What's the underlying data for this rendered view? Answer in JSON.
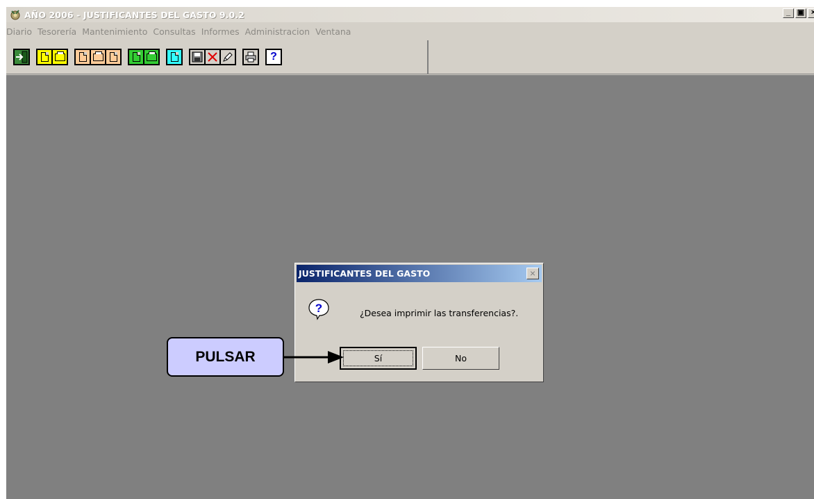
{
  "window": {
    "title": "AÑO 2006 - JUSTIFICANTES DEL GASTO 9.0.2",
    "controls": {
      "minimize": "_",
      "restore": "▣",
      "close": "×"
    }
  },
  "menubar": {
    "items": [
      "Diario",
      "Tesorería",
      "Mantenimiento",
      "Consultas",
      "Informes",
      "Administracion",
      "Ventana"
    ]
  },
  "toolbar": {
    "buttons": [
      {
        "icon": "exit-icon"
      },
      {
        "icon": "new-yellow-doc-icon",
        "accent": "#ffff00"
      },
      {
        "icon": "open-yellow-folder-icon",
        "accent": "#ffff00"
      },
      {
        "icon": "new-orange-doc-icon",
        "accent": "#ffcc99"
      },
      {
        "icon": "open-orange-folder-icon",
        "accent": "#ffcc99"
      },
      {
        "icon": "doc-orange-icon",
        "accent": "#ffcc99"
      },
      {
        "icon": "new-green-doc-icon",
        "accent": "#33cc33"
      },
      {
        "icon": "open-green-folder-icon",
        "accent": "#33cc33"
      },
      {
        "icon": "new-cyan-doc-icon",
        "accent": "#33ffff"
      },
      {
        "icon": "save-icon"
      },
      {
        "icon": "delete-icon"
      },
      {
        "icon": "edit-icon"
      },
      {
        "icon": "print-icon"
      },
      {
        "icon": "help-icon"
      }
    ],
    "help_label": "?"
  },
  "dialog": {
    "title": "JUSTIFICANTES DEL GASTO",
    "close": "×",
    "message": "¿Desea imprimir las transferencias?.",
    "icon_label": "?",
    "yes_label": "Sí",
    "no_label": "No"
  },
  "annotation": {
    "label": "PULSAR"
  },
  "colors": {
    "workspace": "#808080",
    "face": "#d4d0c8",
    "dialog_title_start": "#0a246a",
    "dialog_title_end": "#a6caf0",
    "callout": "#ccccff"
  }
}
